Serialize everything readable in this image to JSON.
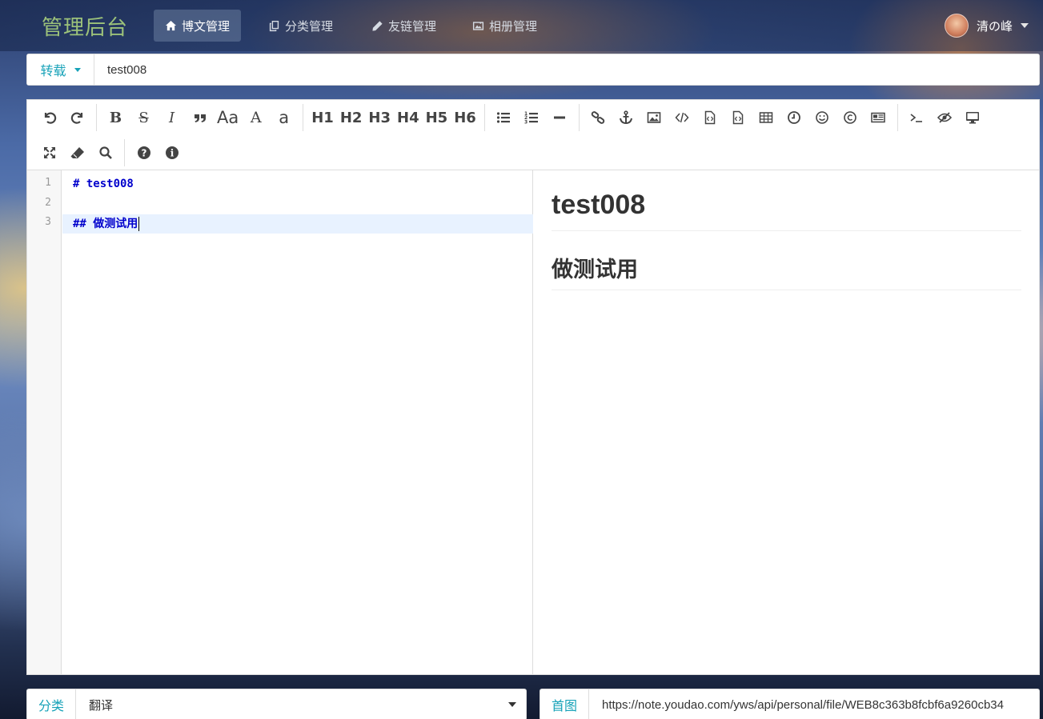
{
  "brand": "管理后台",
  "nav": [
    {
      "label": "博文管理",
      "icon": "home-icon",
      "active": true
    },
    {
      "label": "分类管理",
      "icon": "copy-icon",
      "active": false
    },
    {
      "label": "友链管理",
      "icon": "pencil-icon",
      "active": false
    },
    {
      "label": "相册管理",
      "icon": "image-icon",
      "active": false
    }
  ],
  "user": {
    "name": "清の峰"
  },
  "post": {
    "type_label": "转载",
    "title_value": "test008"
  },
  "toolbar": {
    "undo": "undo-icon",
    "redo": "redo-icon",
    "bold": "B",
    "strike": "S",
    "italic": "I",
    "quote": "quote-icon",
    "uppercase": "Aa",
    "uppercase2": "A",
    "lowercase": "a",
    "h1": "H1",
    "h2": "H2",
    "h3": "H3",
    "h4": "H4",
    "h5": "H5",
    "h6": "H6"
  },
  "editor": {
    "lines": [
      {
        "num": "1",
        "text": "# test008"
      },
      {
        "num": "2",
        "text": ""
      },
      {
        "num": "3",
        "text": "## 做测试用"
      }
    ]
  },
  "preview": {
    "h1": "test008",
    "h2": "做测试用"
  },
  "footer": {
    "category_label": "分类",
    "category_value": "翻译",
    "cover_label": "首图",
    "cover_value": "https://note.youdao.com/yws/api/personal/file/WEB8c363b8fcbf6a9260cb34"
  },
  "colors": {
    "accent": "#17a2b8",
    "code": "#0000cc",
    "brand": "#9cc27a"
  }
}
